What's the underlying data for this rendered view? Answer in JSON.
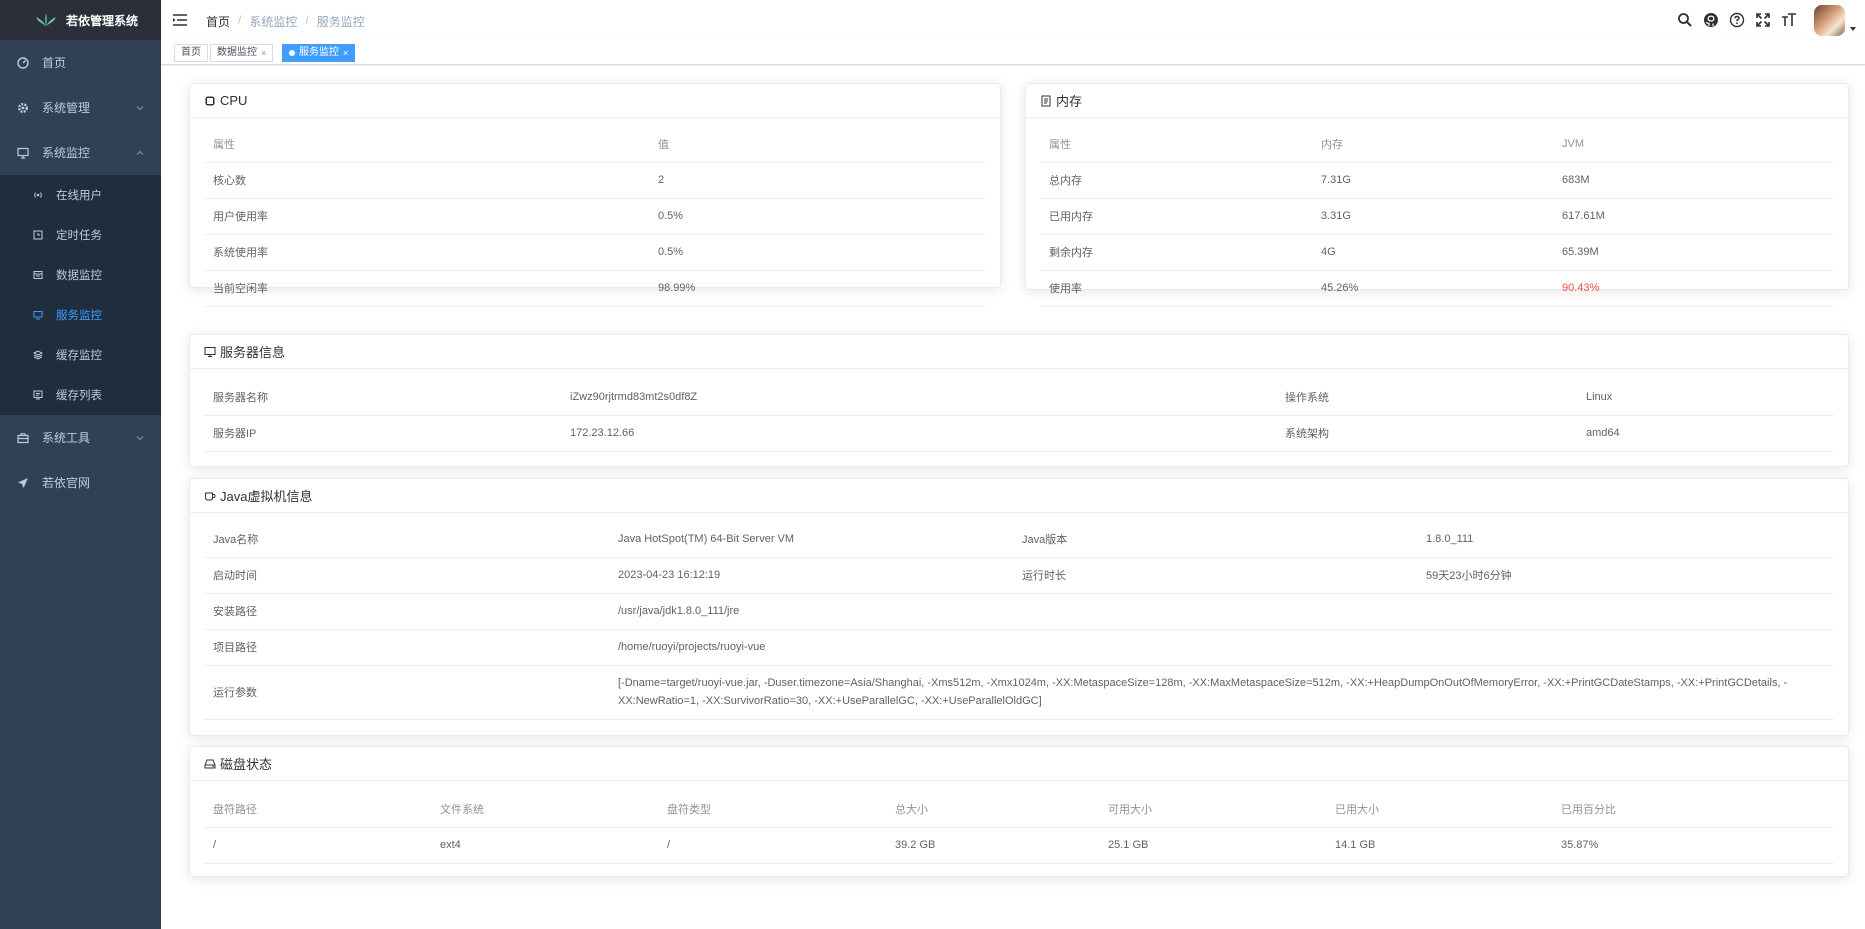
{
  "sidebar": {
    "title": "若依管理系统",
    "items": [
      {
        "label": "首页",
        "icon": "dashboard-icon"
      },
      {
        "label": "系统管理",
        "icon": "gear-icon"
      },
      {
        "label": "系统监控",
        "icon": "monitor-icon",
        "expanded": true
      },
      {
        "label": "系统工具",
        "icon": "toolbox-icon"
      },
      {
        "label": "若依官网",
        "icon": "send-icon"
      }
    ],
    "monitor_children": [
      {
        "label": "在线用户",
        "icon": "online-icon"
      },
      {
        "label": "定时任务",
        "icon": "job-icon"
      },
      {
        "label": "数据监控",
        "icon": "druid-icon"
      },
      {
        "label": "服务监控",
        "icon": "server-icon",
        "active": true
      },
      {
        "label": "缓存监控",
        "icon": "redis-icon"
      },
      {
        "label": "缓存列表",
        "icon": "cache-list-icon"
      }
    ]
  },
  "breadcrumb": [
    "首页",
    "系统监控",
    "服务监控"
  ],
  "tags": [
    {
      "label": "首页"
    },
    {
      "label": "数据监控",
      "close": "×"
    },
    {
      "label": "服务监控",
      "close": "×",
      "active": true
    }
  ],
  "cpu": {
    "title": "CPU",
    "rows": [
      [
        "属性",
        "值"
      ],
      [
        "核心数",
        "2"
      ],
      [
        "用户使用率",
        "0.5%"
      ],
      [
        "系统使用率",
        "0.5%"
      ],
      [
        "当前空闲率",
        "98.99%"
      ]
    ]
  },
  "mem": {
    "title": "内存",
    "rows": [
      [
        "属性",
        "内存",
        "JVM"
      ],
      [
        "总内存",
        "7.31G",
        "683M"
      ],
      [
        "已用内存",
        "3.31G",
        "617.61M"
      ],
      [
        "剩余内存",
        "4G",
        "65.39M"
      ],
      [
        "使用率",
        "45.26%",
        "90.43%"
      ]
    ]
  },
  "server": {
    "title": "服务器信息",
    "rows": [
      [
        "服务器名称",
        "iZwz90rjtrmd83mt2s0df8Z",
        "操作系统",
        "Linux"
      ],
      [
        "服务器IP",
        "172.23.12.66",
        "系统架构",
        "amd64"
      ]
    ]
  },
  "jvm": {
    "title": "Java虚拟机信息",
    "row1": [
      "Java名称",
      "Java HotSpot(TM) 64-Bit Server VM",
      "Java版本",
      "1.8.0_111"
    ],
    "row2": [
      "启动时间",
      "2023-04-23 16:12:19",
      "运行时长",
      "59天23小时6分钟"
    ],
    "row3": [
      "安装路径",
      "/usr/java/jdk1.8.0_111/jre"
    ],
    "row4": [
      "项目路径",
      "/home/ruoyi/projects/ruoyi-vue"
    ],
    "row5": [
      "运行参数",
      "[-Dname=target/ruoyi-vue.jar, -Duser.timezone=Asia/Shanghai, -Xms512m, -Xmx1024m, -XX:MetaspaceSize=128m, -XX:MaxMetaspaceSize=512m, -XX:+HeapDumpOnOutOfMemoryError, -XX:+PrintGCDateStamps, -XX:+PrintGCDetails, -XX:NewRatio=1, -XX:SurvivorRatio=30, -XX:+UseParallelGC, -XX:+UseParallelOldGC]"
    ]
  },
  "disk": {
    "title": "磁盘状态",
    "headers": [
      "盘符路径",
      "文件系统",
      "盘符类型",
      "总大小",
      "可用大小",
      "已用大小",
      "已用百分比"
    ],
    "rows": [
      [
        "/",
        "ext4",
        "/",
        "39.2 GB",
        "25.1 GB",
        "14.1 GB",
        "35.87%"
      ]
    ]
  },
  "colors": {
    "sidebar_bg": "#304156",
    "sub_bg": "#1f2d3d",
    "accent": "#409eff",
    "danger": "#ff4949"
  }
}
